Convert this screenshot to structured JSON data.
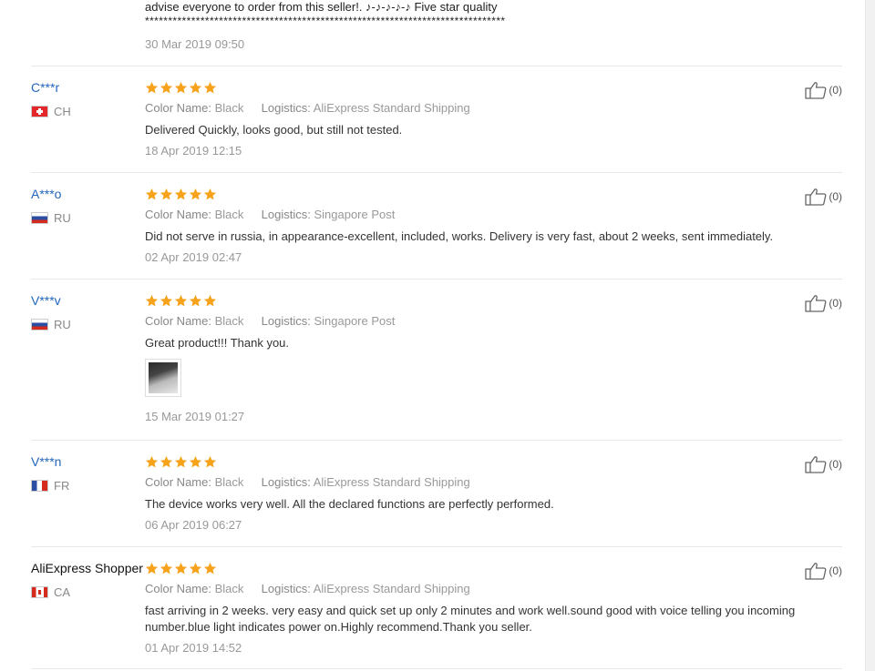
{
  "top_fragment": {
    "text_line": "advise everyone to order from this seller!. ♪-♪-♪-♪-♪ Five star quality",
    "asterisks": "******************************************************************************",
    "date": "30 Mar 2019 09:50"
  },
  "labels": {
    "color_name": "Color Name:",
    "logistics": "Logistics:"
  },
  "colors": {
    "link": "#2266bb",
    "star": "#f7a21b",
    "muted": "#999999"
  },
  "reviews": [
    {
      "user": "C***r",
      "country": "CH",
      "flag": "flag-ch",
      "stars": 5,
      "color": "Black",
      "logistics": "AliExpress Standard Shipping",
      "text": "Delivered Quickly, looks good, but still not tested.",
      "date": "18 Apr 2019 12:15",
      "likes": "(0)"
    },
    {
      "user": "A***o",
      "country": "RU",
      "flag": "flag-ru",
      "stars": 5,
      "color": "Black",
      "logistics": "Singapore Post",
      "text": "Did not serve in russia, in appearance-excellent, included, works. Delivery is very fast, about 2 weeks, sent immediately.",
      "date": "02 Apr 2019 02:47",
      "likes": "(0)"
    },
    {
      "user": "V***v",
      "country": "RU",
      "flag": "flag-ru",
      "stars": 5,
      "color": "Black",
      "logistics": "Singapore Post",
      "text": "Great product!!! Thank you.",
      "has_photo": true,
      "date": "15 Mar 2019 01:27",
      "likes": "(0)"
    },
    {
      "user": "V***n",
      "country": "FR",
      "flag": "flag-fr",
      "stars": 5,
      "color": "Black",
      "logistics": "AliExpress Standard Shipping",
      "text": "The device works very well. All the declared functions are perfectly performed.",
      "date": "06 Apr 2019 06:27",
      "likes": "(0)"
    },
    {
      "user": "AliExpress Shopper",
      "country": "CA",
      "flag": "flag-ca",
      "stars": 5,
      "color": "Black",
      "logistics": "AliExpress Standard Shipping",
      "text": "fast arriving in 2 weeks. very easy and quick set up only 2 minutes and work well.sound good with voice telling you incoming number.blue light indicates power on.Highly recommend.Thank you seller.",
      "date": "01 Apr 2019 14:52",
      "likes": "(0)"
    }
  ]
}
